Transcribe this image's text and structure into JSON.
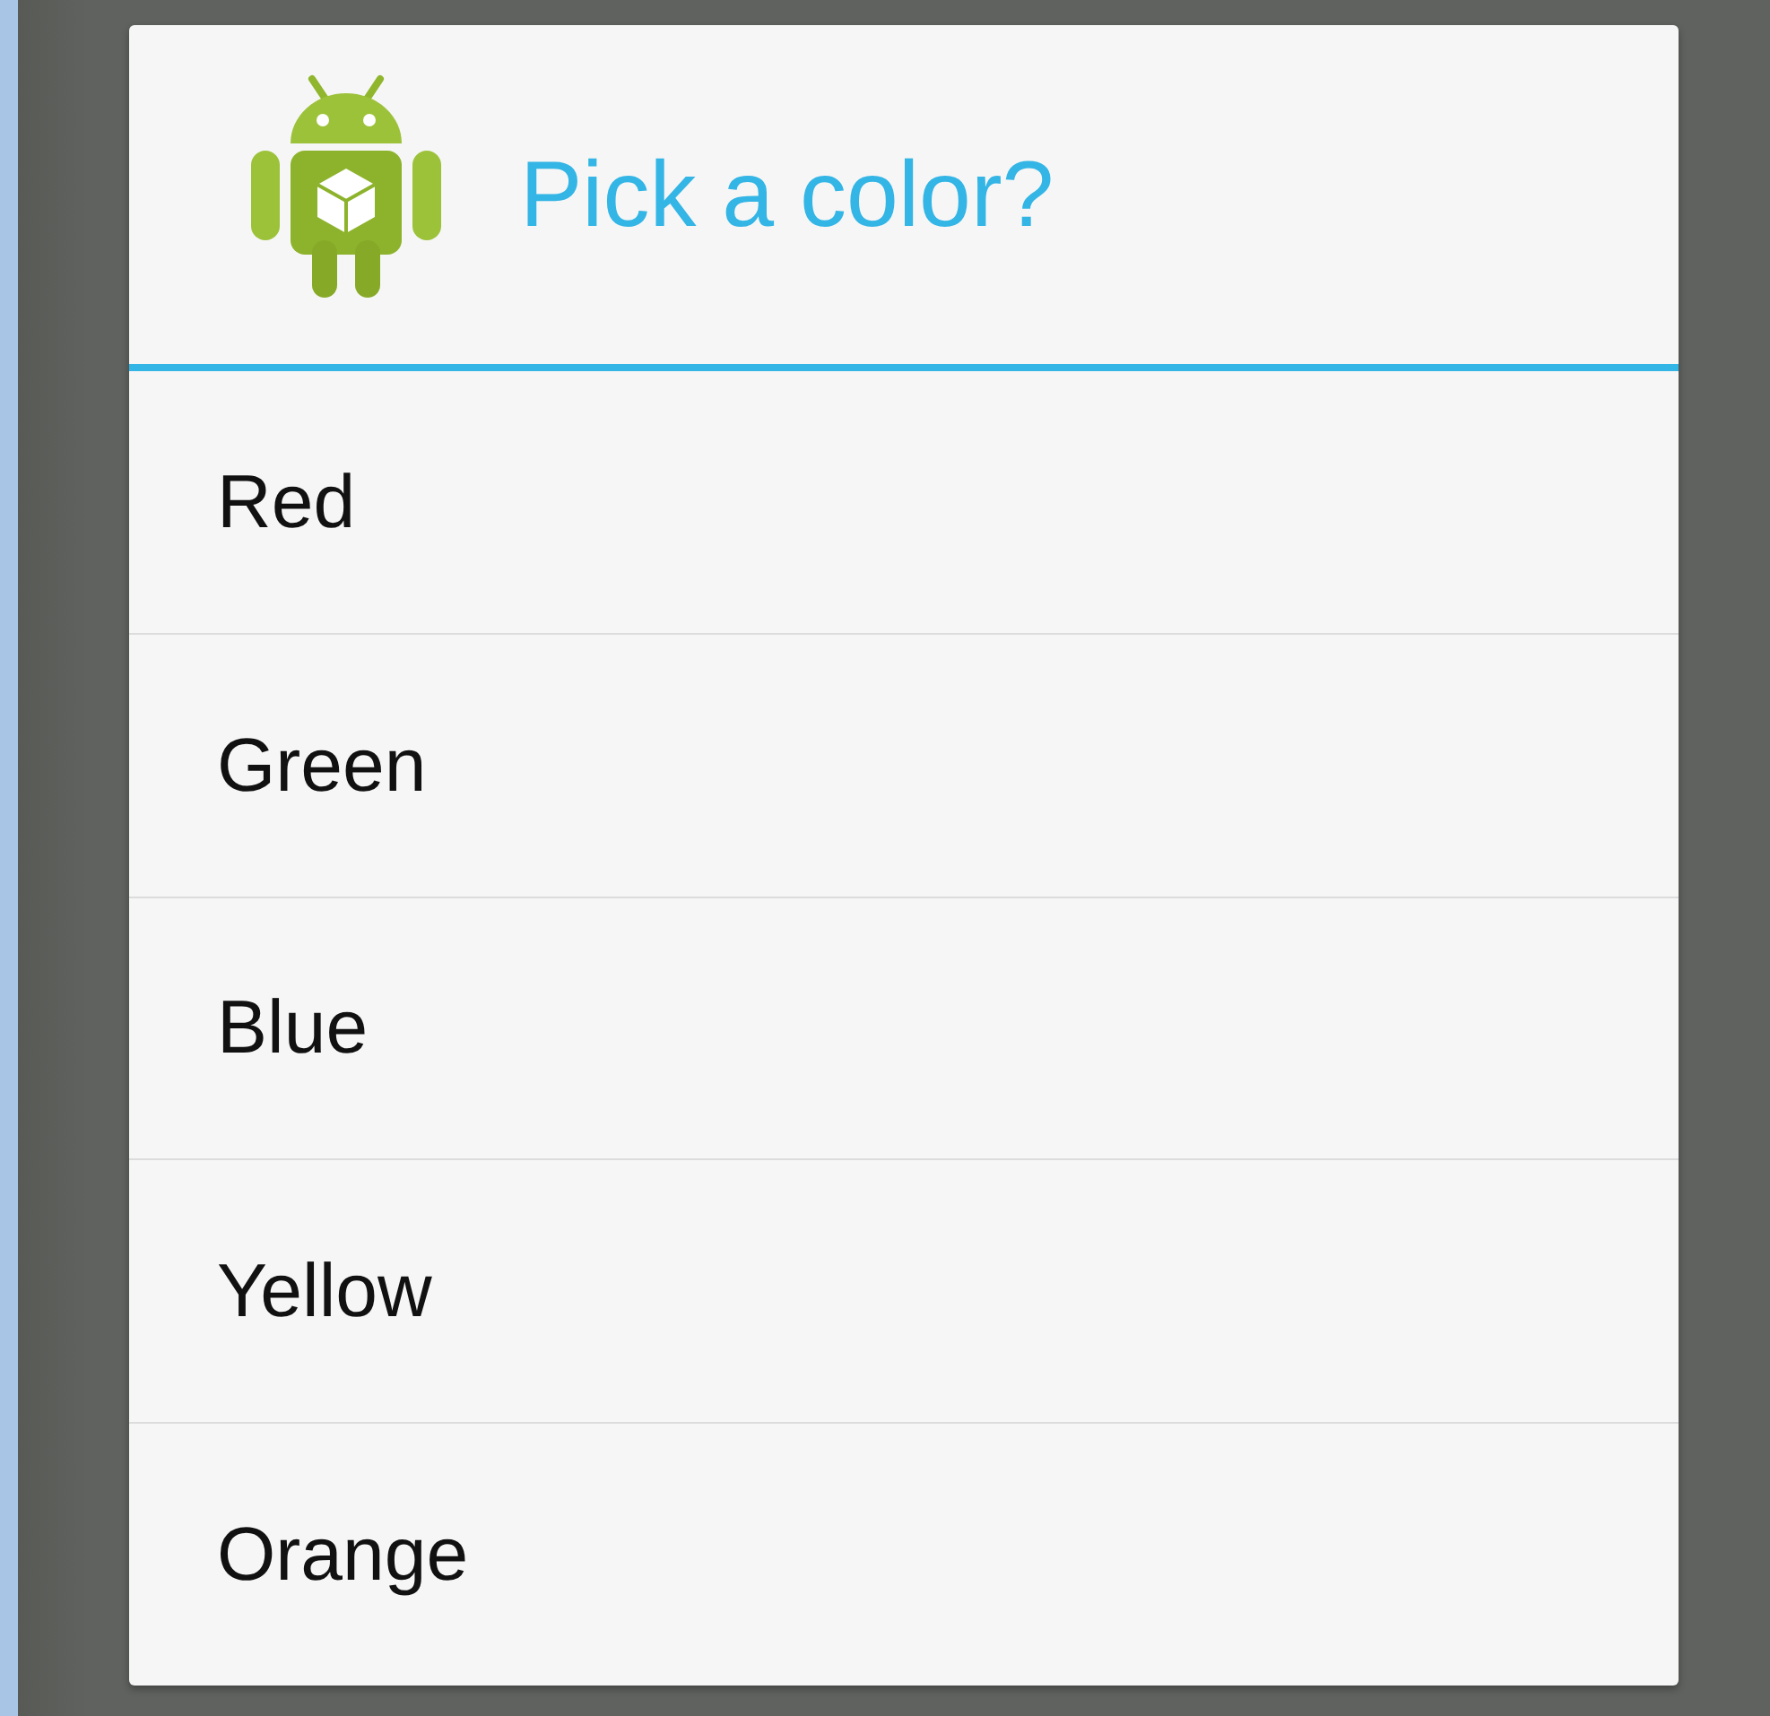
{
  "dialog": {
    "title": "Pick a color?",
    "items": [
      {
        "label": "Red"
      },
      {
        "label": "Green"
      },
      {
        "label": "Blue"
      },
      {
        "label": "Yellow"
      },
      {
        "label": "Orange"
      }
    ]
  }
}
